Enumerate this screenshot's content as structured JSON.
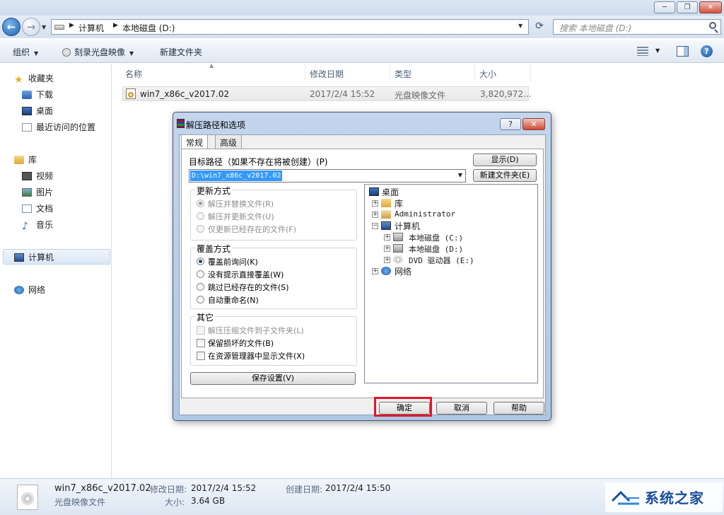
{
  "window": {
    "min_label": "─",
    "max_label": "❐",
    "close_label": "✕"
  },
  "nav": {
    "breadcrumb": [
      "计算机",
      "本地磁盘 (D:)"
    ],
    "search_placeholder": "搜索 本地磁盘 (D:)"
  },
  "toolbar": {
    "organize": "组织",
    "burn": "刻录光盘映像",
    "new_folder": "新建文件夹"
  },
  "sidebar": {
    "favorites": "收藏夹",
    "downloads": "下载",
    "desktop": "桌面",
    "recent": "最近访问的位置",
    "libraries": "库",
    "videos": "视频",
    "pictures": "图片",
    "documents": "文档",
    "music": "音乐",
    "computer": "计算机",
    "network": "网络"
  },
  "filelist": {
    "columns": [
      "名称",
      "修改日期",
      "类型",
      "大小"
    ],
    "rows": [
      {
        "name": "win7_x86c_v2017.02",
        "date": "2017/2/4 15:52",
        "type": "光盘映像文件",
        "size": "3,820,972..."
      }
    ]
  },
  "dialog": {
    "title": "解压路径和选项",
    "help_btn": "?",
    "close_btn": "✕",
    "tabs": [
      "常规",
      "高级"
    ],
    "target_label": "目标路径（如果不存在将被创建）(P)",
    "target_value": "D:\\win7_x86c_v2017.02",
    "show_button": "显示(D)",
    "new_folder_button": "新建文件夹(E)",
    "update_group": {
      "title": "更新方式",
      "options": [
        "解压并替换文件(R)",
        "解压并更新文件(U)",
        "仅更新已经存在的文件(F)"
      ]
    },
    "overwrite_group": {
      "title": "覆盖方式",
      "options": [
        "覆盖前询问(K)",
        "没有提示直接覆盖(W)",
        "跳过已经存在的文件(S)",
        "自动重命名(N)"
      ]
    },
    "misc_group": {
      "title": "其它",
      "options": [
        "解压压缩文件到子文件夹(L)",
        "保留损坏的文件(B)",
        "在资源管理器中显示文件(X)"
      ]
    },
    "save_settings": "保存设置(V)",
    "tree": {
      "desktop": "桌面",
      "libraries": "库",
      "administrator": "Administrator",
      "computer": "计算机",
      "drive_c": "本地磁盘 (C:)",
      "drive_d": "本地磁盘 (D:)",
      "drive_e": "DVD 驱动器 (E:)",
      "network": "网络"
    },
    "ok": "确定",
    "cancel": "取消",
    "help": "帮助"
  },
  "details": {
    "filename": "win7_x86c_v2017.02",
    "filetype": "光盘映像文件",
    "modified_label": "修改日期:",
    "modified_value": "2017/2/4 15:52",
    "created_label": "创建日期:",
    "created_value": "2017/2/4 15:50",
    "size_label": "大小:",
    "size_value": "3.64 GB"
  },
  "watermark": {
    "text": "系统之家"
  },
  "colors": {
    "highlight_box": "#e0162b",
    "selection": "#3399ff",
    "titlebar": "#cddbeb"
  }
}
